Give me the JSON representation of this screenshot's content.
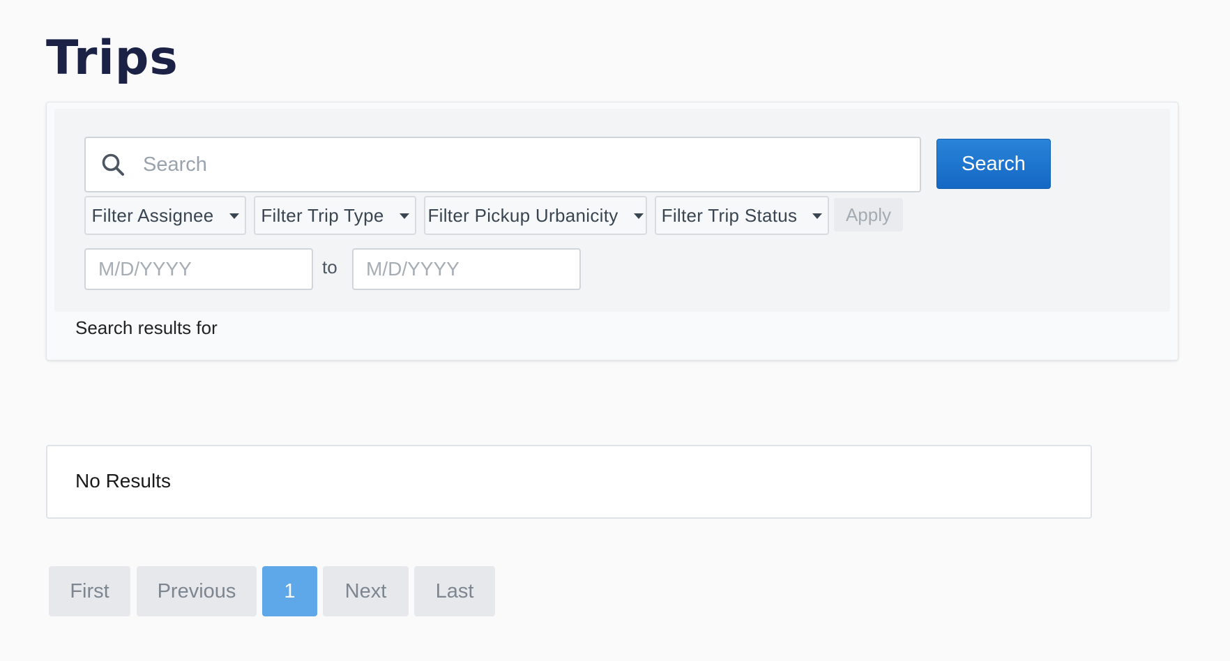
{
  "page": {
    "title": "Trips"
  },
  "search": {
    "placeholder": "Search",
    "value": "",
    "button_label": "Search",
    "icon": "search-icon"
  },
  "filters": [
    {
      "label": "Filter Assignee"
    },
    {
      "label": "Filter Trip Type"
    },
    {
      "label": "Filter Pickup Urbanicity"
    },
    {
      "label": "Filter Trip Status"
    }
  ],
  "apply_label": "Apply",
  "date_range": {
    "from_placeholder": "M/D/YYYY",
    "separator": "to",
    "to_placeholder": "M/D/YYYY"
  },
  "results_for_label": "Search results for",
  "results": {
    "empty_text": "No Results"
  },
  "pagination": {
    "first": "First",
    "previous": "Previous",
    "current_page": "1",
    "next": "Next",
    "last": "Last"
  },
  "colors": {
    "title": "#1b2245",
    "primary": "#1a73cf",
    "active_page": "#5ea8ea"
  }
}
